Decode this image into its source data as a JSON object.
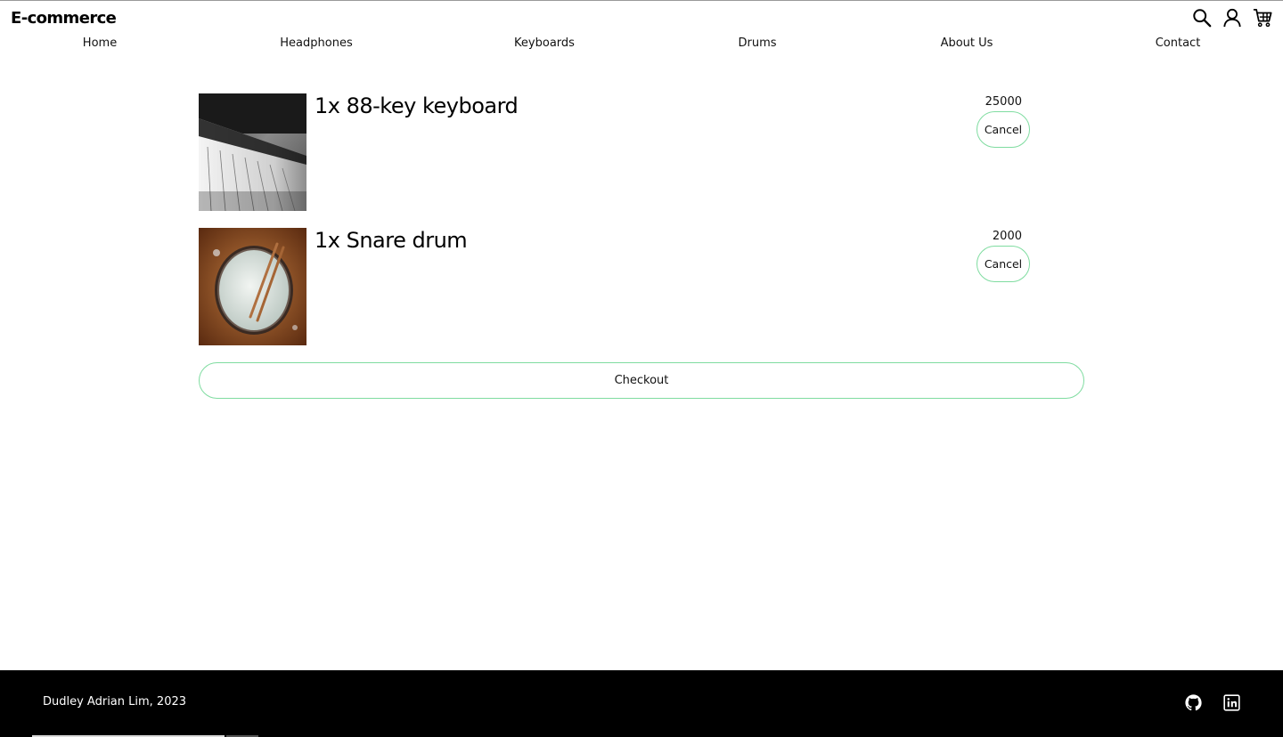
{
  "header": {
    "brand": "E-commerce",
    "icons": [
      "search-icon",
      "user-icon",
      "cart-icon"
    ]
  },
  "nav": {
    "items": [
      {
        "label": "Home"
      },
      {
        "label": "Headphones"
      },
      {
        "label": "Keyboards"
      },
      {
        "label": "Drums"
      },
      {
        "label": "About Us"
      },
      {
        "label": "Contact"
      }
    ]
  },
  "cart": {
    "items": [
      {
        "title": "1x 88-key keyboard",
        "price": "25000",
        "cancel_label": "Cancel",
        "image": "piano-keys-photo"
      },
      {
        "title": "1x Snare drum",
        "price": "2000",
        "cancel_label": "Cancel",
        "image": "snare-drum-photo"
      }
    ],
    "checkout_label": "Checkout"
  },
  "footer": {
    "text": "Dudley Adrian Lim, 2023",
    "icons": [
      "github-icon",
      "linkedin-icon"
    ]
  },
  "colors": {
    "button_border": "#7fdca0",
    "footer_bg": "#000000"
  }
}
